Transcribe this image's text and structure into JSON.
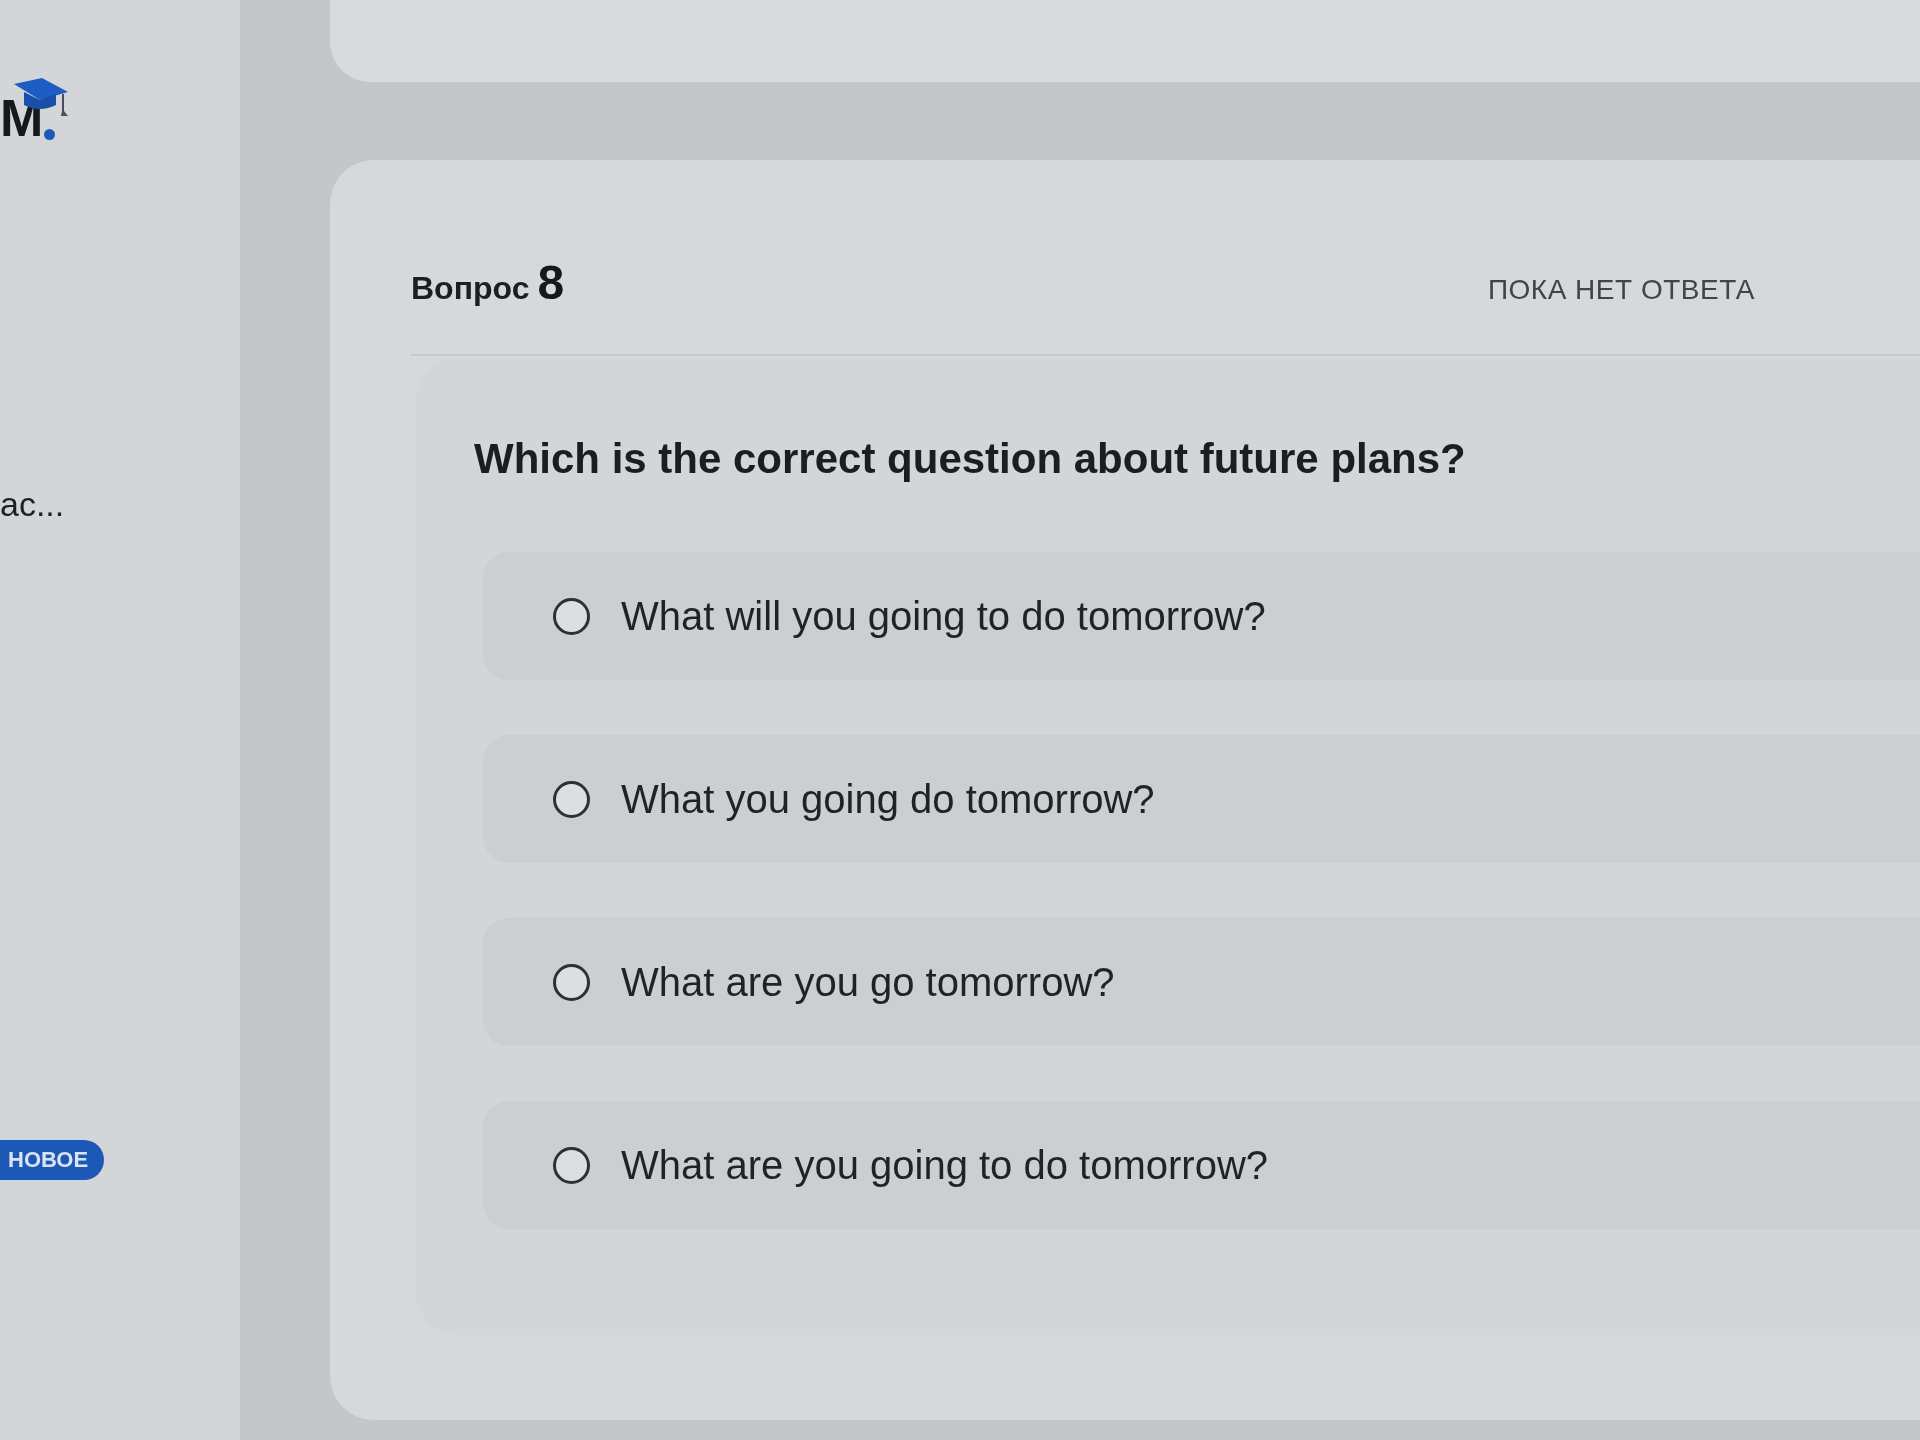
{
  "sidebar": {
    "logo": {
      "text": "M"
    },
    "items": [
      {
        "label": "ас..."
      }
    ],
    "badge": "НОВОЕ"
  },
  "question_card": {
    "title": "Вопрос",
    "number": "8",
    "status": "ПОКА НЕТ ОТВЕТА",
    "question": "Which is the correct question about future plans?",
    "options": [
      {
        "label": "What will you going to do tomorrow?",
        "selected": false
      },
      {
        "label": "What you going do tomorrow?",
        "selected": false
      },
      {
        "label": "What are you go tomorrow?",
        "selected": false
      },
      {
        "label": "What are you going to do tomorrow?",
        "selected": false
      }
    ]
  }
}
